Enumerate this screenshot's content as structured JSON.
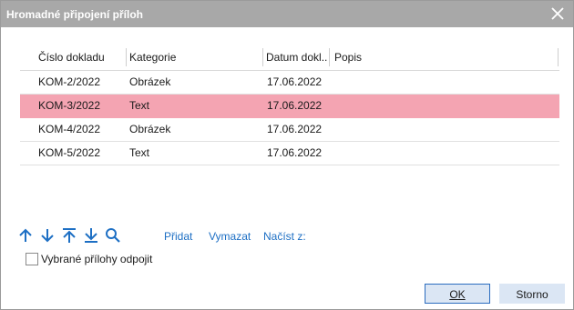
{
  "window": {
    "title": "Hromadné připojení příloh"
  },
  "table": {
    "columns": [
      "Číslo dokladu",
      "Kategorie",
      "Datum dokl...",
      "Popis"
    ],
    "rows": [
      {
        "cislo": "KOM-2/2022",
        "kategorie": "Obrázek",
        "datum": "17.06.2022",
        "popis": "",
        "selected": false
      },
      {
        "cislo": "KOM-3/2022",
        "kategorie": "Text",
        "datum": "17.06.2022",
        "popis": "",
        "selected": true
      },
      {
        "cislo": "KOM-4/2022",
        "kategorie": "Obrázek",
        "datum": "17.06.2022",
        "popis": "",
        "selected": false
      },
      {
        "cislo": "KOM-5/2022",
        "kategorie": "Text",
        "datum": "17.06.2022",
        "popis": "",
        "selected": false
      }
    ]
  },
  "toolbar": {
    "icons": [
      "arrow-up-icon",
      "arrow-down-icon",
      "arrow-top-icon",
      "arrow-bottom-icon",
      "search-icon"
    ],
    "pridat": "Přidat",
    "vymazat": "Vymazat",
    "nacist": "Načíst z:"
  },
  "detach_checkbox": {
    "label": "Vybrané přílohy odpojit",
    "checked": false
  },
  "buttons": {
    "ok": "OK",
    "cancel": "Storno"
  },
  "colors": {
    "titlebar": "#a8a8a8",
    "selected_row": "#f4a4b2",
    "accent": "#1d6fc4",
    "button_bg": "#dbe6f4"
  }
}
